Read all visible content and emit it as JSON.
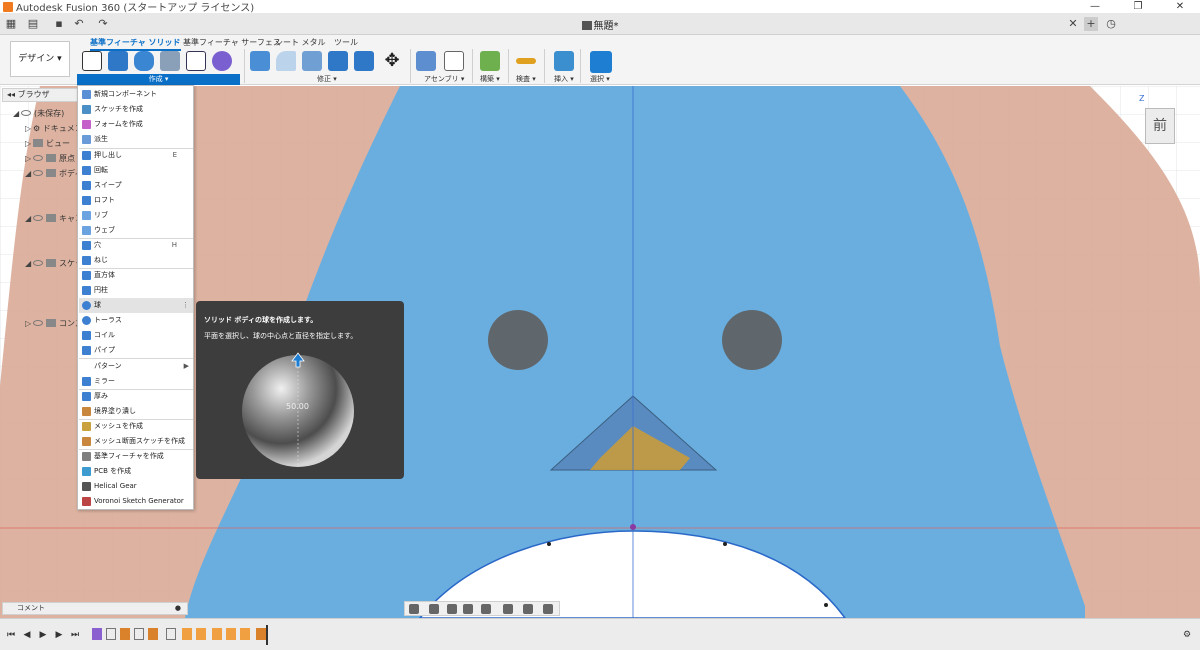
{
  "window": {
    "app_title": "Autodesk Fusion 360 (スタートアップ ライセンス)",
    "controls": {
      "minimize": "—",
      "restore": "❐",
      "close": "✕"
    }
  },
  "quickbar": {
    "doc_title": "無題*",
    "tab_close": "✕",
    "tab_add": "+"
  },
  "toolbar": {
    "workspace_label": "デザイン ▾",
    "tabs": [
      "基準フィーチャ ソリッド",
      "基準フィーチャ サーフェス",
      "シート メタル",
      "ツール"
    ],
    "groups": [
      "作成 ▾",
      "修正 ▾",
      "アセンブリ ▾",
      "構築 ▾",
      "検査 ▾",
      "挿入 ▾",
      "選択 ▾"
    ]
  },
  "browser": {
    "title": "ブラウザ",
    "rows": [
      "(未保存)",
      "ドキュメント設定",
      "ビュー",
      "原点",
      "ボディ",
      "キャンバス",
      "スケッチ",
      "コンストラクション"
    ]
  },
  "create_menu": {
    "items": [
      {
        "label": "新規コンポーネント",
        "icon": "component-icon",
        "color": "#5a8fd6"
      },
      {
        "label": "スケッチを作成",
        "icon": "sketch-icon",
        "color": "#4a90c7"
      },
      {
        "label": "フォームを作成",
        "icon": "form-icon",
        "color": "#c55fc9"
      },
      {
        "label": "派生",
        "icon": "derive-icon",
        "color": "#6a9bd8"
      },
      {
        "label": "押し出し",
        "icon": "extrude-icon",
        "color": "#3d7fd0",
        "shortcut": "E"
      },
      {
        "label": "回転",
        "icon": "revolve-icon",
        "color": "#3d7fd0"
      },
      {
        "label": "スイープ",
        "icon": "sweep-icon",
        "color": "#3d7fd0"
      },
      {
        "label": "ロフト",
        "icon": "loft-icon",
        "color": "#3d7fd0"
      },
      {
        "label": "リブ",
        "icon": "rib-icon",
        "color": "#6aa3e0"
      },
      {
        "label": "ウェブ",
        "icon": "web-icon",
        "color": "#6aa3e0"
      },
      {
        "label": "穴",
        "icon": "hole-icon",
        "color": "#3d7fd0",
        "shortcut": "H"
      },
      {
        "label": "ねじ",
        "icon": "thread-icon",
        "color": "#3d7fd0"
      },
      {
        "label": "直方体",
        "icon": "box-icon",
        "color": "#3d7fd0"
      },
      {
        "label": "円柱",
        "icon": "cylinder-icon",
        "color": "#3d7fd0"
      },
      {
        "label": "球",
        "icon": "sphere-icon",
        "color": "#3d7fd0"
      },
      {
        "label": "トーラス",
        "icon": "torus-icon",
        "color": "#3d7fd0"
      },
      {
        "label": "コイル",
        "icon": "coil-icon",
        "color": "#3d7fd0"
      },
      {
        "label": "パイプ",
        "icon": "pipe-icon",
        "color": "#3d7fd0"
      },
      {
        "label": "パターン",
        "icon": "",
        "color": ""
      },
      {
        "label": "ミラー",
        "icon": "mirror-icon",
        "color": "#3d7fd0"
      },
      {
        "label": "厚み",
        "icon": "thicken-icon",
        "color": "#3d7fd0"
      },
      {
        "label": "境界塗り潰し",
        "icon": "boundary-fill-icon",
        "color": "#c9873d"
      },
      {
        "label": "メッシュを作成",
        "icon": "mesh-icon",
        "color": "#c9a23d"
      },
      {
        "label": "メッシュ断面スケッチを作成",
        "icon": "mesh-section-icon",
        "color": "#c9873d"
      },
      {
        "label": "基準フィーチャを作成",
        "icon": "base-feature-icon",
        "color": "#7f7f7f"
      },
      {
        "label": "PCB を作成",
        "icon": "pcb-icon",
        "color": "#3d9bd0"
      },
      {
        "label": "Helical Gear",
        "icon": "gear-icon",
        "color": "#555555"
      },
      {
        "label": "Voronoi Sketch Generator",
        "icon": "voronoi-icon",
        "color": "#b44"
      }
    ]
  },
  "tooltip": {
    "title": "ソリッド ボディの球を作成します。",
    "description": "平面を選択し、球の中心点と直径を指定します。",
    "preview_value": "50.00"
  },
  "viewcube": {
    "face": "前",
    "axis_z": "Z"
  },
  "comments": {
    "label": "コメント"
  },
  "colors": {
    "accent": "#0a6fc7",
    "penguin_body": "#6aaee0",
    "background_pink": "#d9aa96",
    "eyes": "#5f5f5f",
    "beak": "#d69d2b"
  }
}
